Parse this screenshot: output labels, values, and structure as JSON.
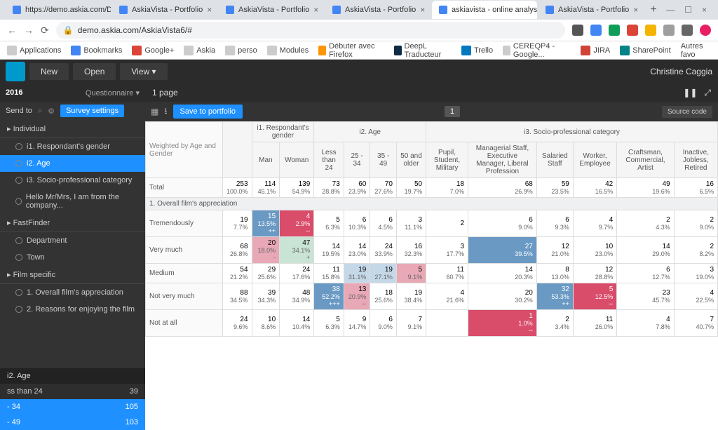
{
  "browser": {
    "tabs": [
      {
        "label": "https://demo.askia.com/De..."
      },
      {
        "label": "AskiaVista - Portfolio"
      },
      {
        "label": "AskiaVista - Portfolio"
      },
      {
        "label": "AskiaVista - Portfolio"
      },
      {
        "label": "askiavista - online analysis c"
      },
      {
        "label": "AskiaVista - Portfolio"
      }
    ],
    "url": "demo.askia.com/AskiaVista6/#",
    "bookmarks": [
      "Applications",
      "Bookmarks",
      "Google+",
      "Askia",
      "perso",
      "Modules",
      "Débuter avec Firefox",
      "DeepL Traducteur",
      "Trello",
      "CEREQP4 - Google...",
      "JIRA",
      "SharePoint"
    ],
    "other_favs": "Autres favo"
  },
  "app": {
    "buttons": {
      "new": "New",
      "open": "Open",
      "view": "View"
    },
    "user": "Christine Caggia",
    "year": "2016",
    "questionnaire": "Questionnaire",
    "send_to": "Send to",
    "survey_settings": "Survey settings",
    "page_label": "1 page",
    "save_portfolio": "Save to portfolio",
    "source_code": "Source code",
    "pager": "1"
  },
  "sidebar": {
    "groups": [
      {
        "label": "Individual",
        "items": [
          {
            "label": "i1. Respondant's gender"
          },
          {
            "label": "i2. Age",
            "selected": true
          },
          {
            "label": "i3. Socio-professional category"
          },
          {
            "label": "Hello Mr/Mrs, I am from the company..."
          }
        ]
      },
      {
        "label": "FastFinder",
        "items": [
          {
            "label": "Department"
          },
          {
            "label": "Town"
          }
        ]
      },
      {
        "label": "Film specific",
        "items": [
          {
            "label": "1. Overall film's appreciation"
          },
          {
            "label": "2. Reasons for enjoying the film"
          }
        ]
      }
    ],
    "bottom": {
      "header": "i2. Age",
      "rows": [
        {
          "label": "ss than 24",
          "val": "39"
        },
        {
          "label": "- 34",
          "val": "105",
          "blue": true
        },
        {
          "label": "- 49",
          "val": "103",
          "blue": true
        }
      ]
    }
  },
  "table": {
    "corner": "Weighted by Age and Gender",
    "groups": [
      {
        "label": "i1. Respondant's gender",
        "cols": [
          "Man",
          "Woman"
        ]
      },
      {
        "label": "i2. Age",
        "cols": [
          "Less than 24",
          "25 - 34",
          "35 - 49",
          "50 and older"
        ]
      },
      {
        "label": "i3. Socio-professional category",
        "cols": [
          "Pupil, Student, Military",
          "Managerial Staff, Executive Manager, Liberal Profession",
          "Salaried Staff",
          "Worker, Employee",
          "Craftsman, Commercial, Artist",
          "Inactive, Jobless, Retired"
        ]
      }
    ],
    "total_label": "Total",
    "total": {
      "n": [
        "253",
        "114",
        "139",
        "73",
        "60",
        "70",
        "50",
        "18",
        "68",
        "59",
        "42",
        "49",
        "16"
      ],
      "p": [
        "100.0%",
        "45.1%",
        "54.9%",
        "28.8%",
        "23.9%",
        "27.6%",
        "19.7%",
        "7.0%",
        "26.9%",
        "23.5%",
        "16.5%",
        "19.6%",
        "6.5%"
      ]
    },
    "section1": "1. Overall film's appreciation",
    "rows": [
      {
        "label": "Tremendously",
        "n": [
          "19",
          "15",
          "4",
          "5",
          "6",
          "6",
          "3",
          "2",
          "6",
          "6",
          "4",
          "2",
          "2"
        ],
        "p": [
          "7.7%",
          "13.5%",
          "2.9%",
          "6.3%",
          "10.3%",
          "4.5%",
          "11.1%",
          "",
          "9.0%",
          "9.3%",
          "9.7%",
          "4.3%",
          "9.0%"
        ],
        "sig": [
          "",
          "++",
          "--",
          "",
          "",
          "",
          "",
          "",
          "",
          "",
          "",
          "",
          ""
        ],
        "hl": [
          "",
          "hl-blue",
          "hl-red",
          "",
          "",
          "",
          "",
          "",
          "",
          "",
          "",
          "",
          ""
        ]
      },
      {
        "label": "Very much",
        "n": [
          "68",
          "20",
          "47",
          "14",
          "14",
          "24",
          "16",
          "3",
          "27",
          "12",
          "10",
          "14",
          "2"
        ],
        "p": [
          "26.8%",
          "18.0%",
          "34.1%",
          "19.5%",
          "23.0%",
          "33.9%",
          "32.3%",
          "17.7%",
          "39.5%",
          "21.0%",
          "23.0%",
          "29.0%",
          "8.2%"
        ],
        "sig": [
          "",
          "-",
          "+",
          "",
          "",
          "",
          "",
          "",
          "",
          "",
          "",
          "",
          ""
        ],
        "hl": [
          "",
          "hl-pink",
          "hl-ltgreen",
          "",
          "",
          "",
          "",
          "",
          "hl-blue",
          "",
          "",
          "",
          ""
        ]
      },
      {
        "label": "Medium",
        "n": [
          "54",
          "29",
          "24",
          "11",
          "19",
          "19",
          "5",
          "11",
          "14",
          "8",
          "12",
          "6",
          "3"
        ],
        "p": [
          "21.2%",
          "25.6%",
          "17.6%",
          "15.8%",
          "31.1%",
          "27.1%",
          "9.1%",
          "60.7%",
          "20.3%",
          "13.0%",
          "28.8%",
          "12.7%",
          "19.0%"
        ],
        "sig": [
          "",
          "",
          "",
          "",
          "",
          "",
          "",
          "",
          "",
          "",
          "",
          "",
          ""
        ],
        "hl": [
          "",
          "",
          "",
          "",
          "hl-ltblue",
          "hl-ltblue",
          "hl-pink",
          "",
          "",
          "",
          "",
          "",
          ""
        ]
      },
      {
        "label": "Not very much",
        "n": [
          "88",
          "39",
          "48",
          "38",
          "13",
          "18",
          "19",
          "4",
          "20",
          "32",
          "5",
          "23",
          "4"
        ],
        "p": [
          "34.5%",
          "34.3%",
          "34.9%",
          "52.2%",
          "20.9%",
          "25.6%",
          "38.4%",
          "21.6%",
          "30.2%",
          "53.3%",
          "12.5%",
          "45.7%",
          "22.5%"
        ],
        "sig": [
          "",
          "",
          "",
          "+++",
          "--",
          "",
          "",
          "",
          "",
          "++",
          "--",
          "",
          ""
        ],
        "hl": [
          "",
          "",
          "",
          "hl-blue",
          "hl-pink",
          "",
          "",
          "",
          "",
          "hl-blue",
          "hl-red",
          "",
          ""
        ]
      },
      {
        "label": "Not at all",
        "n": [
          "24",
          "10",
          "14",
          "5",
          "9",
          "6",
          "7",
          "",
          "1",
          "2",
          "11",
          "4",
          "7"
        ],
        "p": [
          "9.6%",
          "8.6%",
          "10.4%",
          "6.3%",
          "14.7%",
          "9.0%",
          "9.1%",
          "",
          "1.0%",
          "3.4%",
          "26.0%",
          "7.8%",
          "40.7%"
        ],
        "sig": [
          "",
          "",
          "",
          "",
          "",
          "",
          "",
          "",
          "--",
          "",
          "",
          "",
          ""
        ],
        "hl": [
          "",
          "",
          "",
          "",
          "",
          "",
          "",
          "",
          "hl-red",
          "",
          "",
          "",
          ""
        ]
      }
    ]
  }
}
